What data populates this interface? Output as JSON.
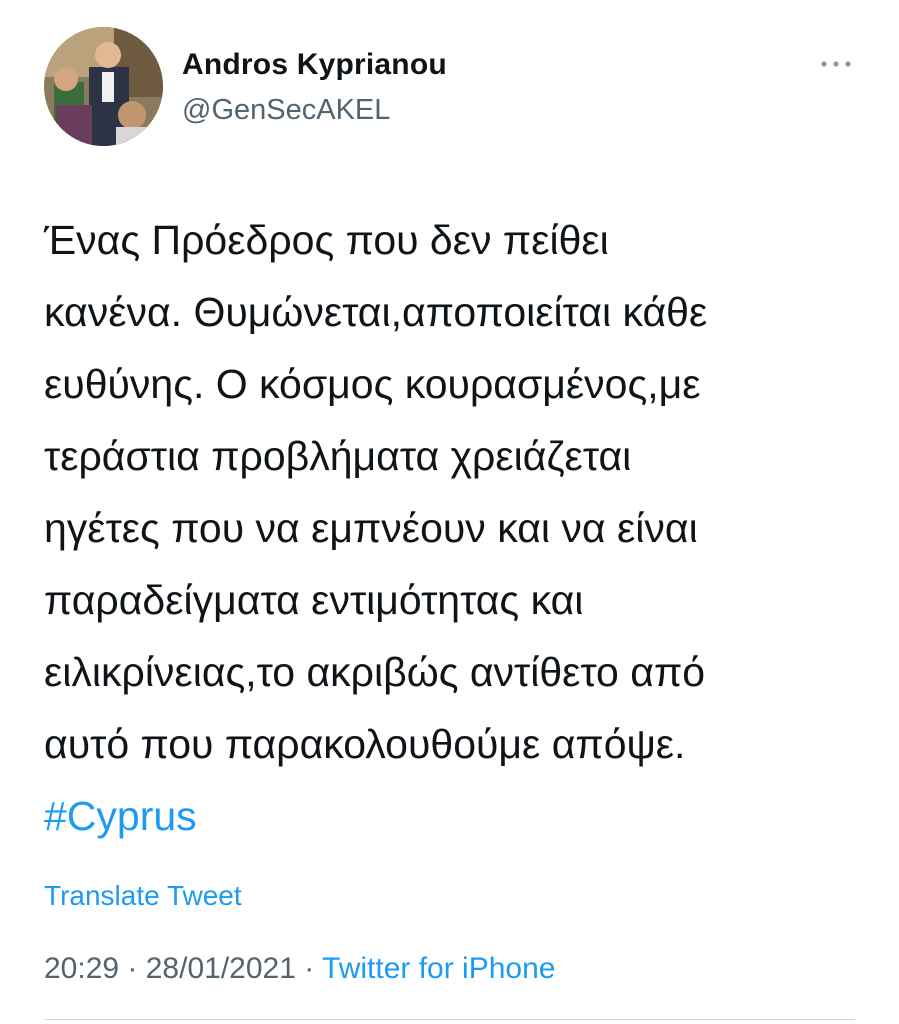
{
  "author": {
    "display_name": "Andros Kyprianou",
    "handle": "@GenSecAKEL",
    "avatar_icon": "profile-photo"
  },
  "more_icon": "more-horizontal-icon",
  "tweet": {
    "lines": [
      "Ένας Πρόεδρος που δεν πείθει",
      "κανένα. Θυμώνεται,αποποιείται κάθε",
      "ευθύνης. Ο κόσμος κουρασμένος,με",
      "τεράστια προβλήματα χρειάζεται",
      "ηγέτες που να εμπνέουν και να είναι",
      "παραδείγματα εντιμότητας και",
      "ειλικρίνειας,το ακριβώς αντίθετο από",
      "αυτό που παρακολουθούμε απόψε."
    ],
    "hashtag": "#Cyprus"
  },
  "translate_label": "Translate Tweet",
  "meta": {
    "time": "20:29",
    "date": "28/01/2021",
    "separator": " · ",
    "source": "Twitter for iPhone"
  },
  "colors": {
    "text": "#0f1419",
    "secondary": "#536471",
    "link": "#1d9bf0",
    "divider": "#cfd9de"
  }
}
